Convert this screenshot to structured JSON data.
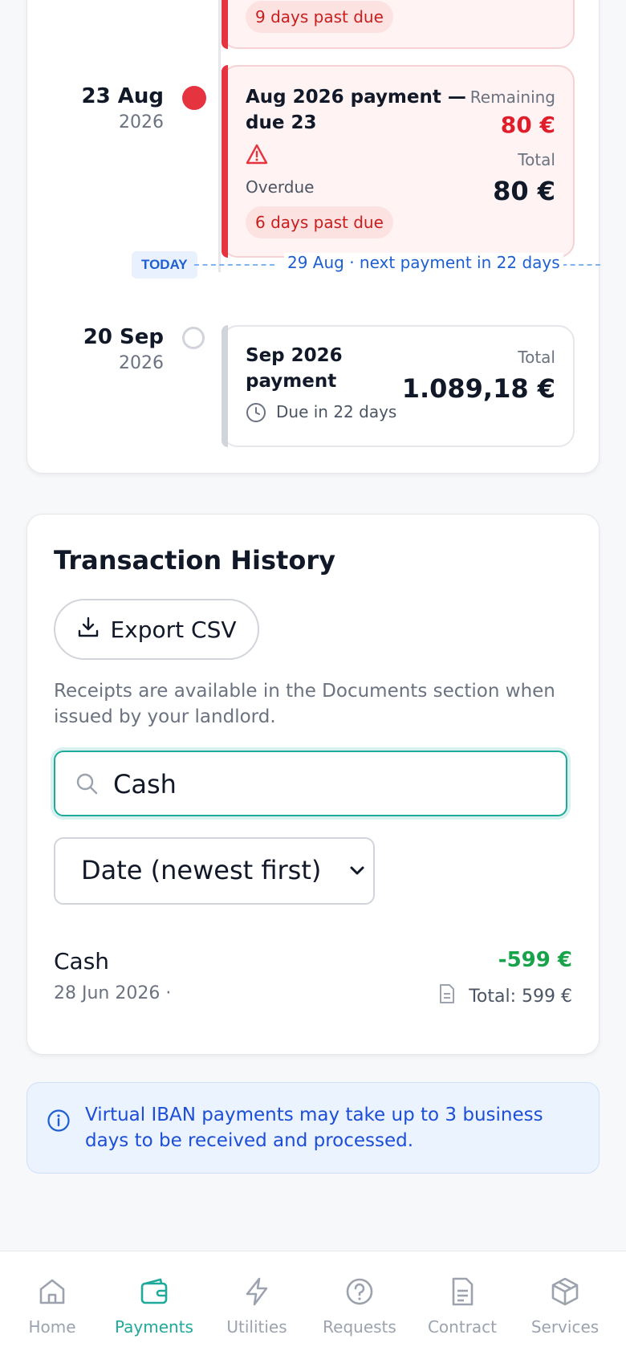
{
  "timeline": {
    "prev_item": {
      "badge": "9 days past due"
    },
    "items": [
      {
        "date": "23 Aug",
        "year": "2026",
        "title_line1": "Aug 2026 payment —",
        "title_line2": "due 23",
        "status": "Overdue",
        "badge": "6 days past due",
        "remaining_label": "Remaining",
        "remaining_value": "80 €",
        "total_label": "Total",
        "total_value": "80 €"
      },
      {
        "date": "20 Sep",
        "year": "2026",
        "title_line1": "Sep 2026",
        "title_line2": "payment",
        "due_text": "Due in 22 days",
        "total_label": "Total",
        "total_value": "1.089,18 €"
      }
    ],
    "today_label": "TODAY",
    "today_text": "29 Aug · next payment in 22 days"
  },
  "transactions": {
    "title": "Transaction History",
    "export_label": "Export CSV",
    "note": "Receipts are available in the Documents section when issued by your landlord.",
    "search_value": "Cash",
    "sort_selected": "Date (newest first)",
    "rows": [
      {
        "name": "Cash",
        "date": "28 Jun 2026 ·",
        "amount": "-599 €",
        "total": "Total: 599 €"
      }
    ]
  },
  "info": {
    "text": "Virtual IBAN payments may take up to 3 business days to be received and processed."
  },
  "nav": {
    "items": [
      {
        "label": "Home",
        "icon": "home-icon"
      },
      {
        "label": "Payments",
        "icon": "wallet-icon",
        "active": true
      },
      {
        "label": "Utilities",
        "icon": "bolt-icon"
      },
      {
        "label": "Requests",
        "icon": "help-circle-icon"
      },
      {
        "label": "Contract",
        "icon": "document-icon"
      },
      {
        "label": "Services",
        "icon": "box-icon"
      }
    ]
  },
  "colors": {
    "accent": "#1fa99b",
    "danger": "#e53340",
    "success": "#16a34a",
    "info": "#1d5fd1"
  }
}
